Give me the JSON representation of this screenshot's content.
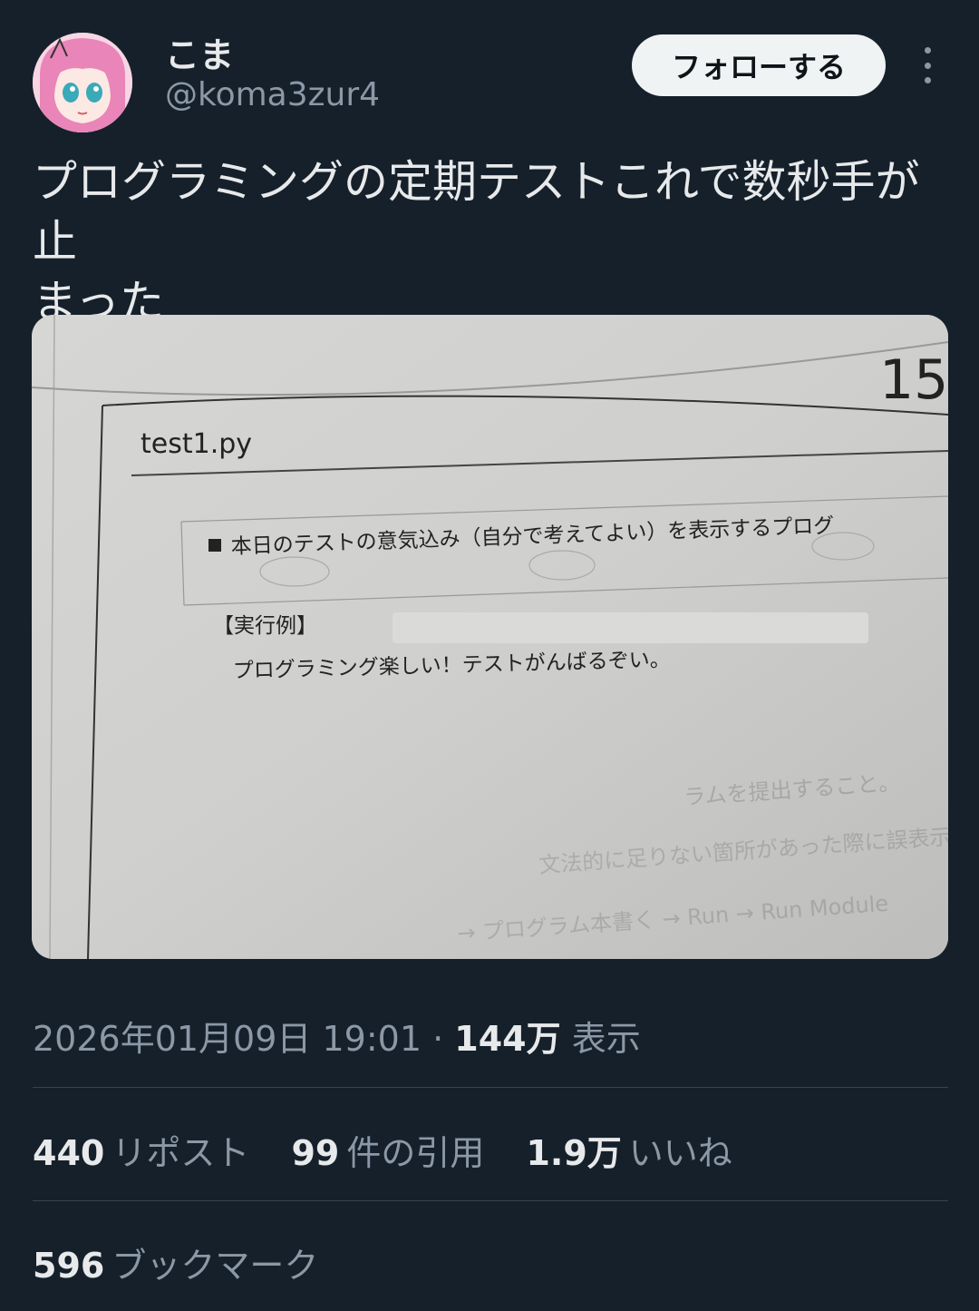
{
  "user": {
    "display_name": "こま",
    "handle": "@koma3zur4"
  },
  "follow_label": "フォローする",
  "tweet_text": "プログラミングの定期テストこれで数秒手が止\nまった",
  "photo": {
    "page_number": "15",
    "filename": "test1.py",
    "question": "本日のテストの意気込み（自分で考えてよい）を表示するプログ",
    "example_label": "【実行例】",
    "example_output": "プログラミング楽しい！テストがんばるぞい。"
  },
  "meta": {
    "timestamp": "2026年01月09日 19:01",
    "separator": "·",
    "views_count": "144万",
    "views_label": "表示"
  },
  "stats": {
    "reposts_count": "440",
    "reposts_label": "リポスト",
    "quotes_count": "99",
    "quotes_label": "件の引用",
    "likes_count": "1.9万",
    "likes_label": "いいね"
  },
  "bookmarks": {
    "count": "596",
    "label": "ブックマーク"
  }
}
